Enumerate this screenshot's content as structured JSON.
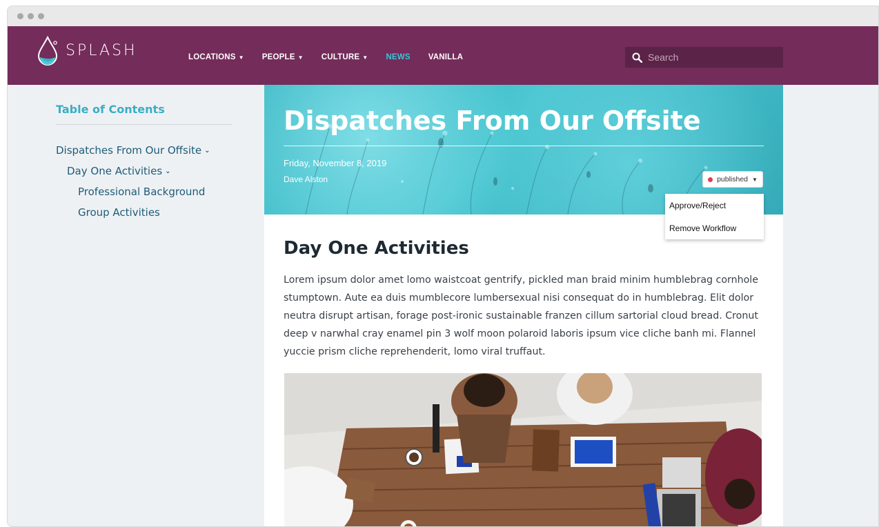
{
  "nav": {
    "logo_text": "SPLASH",
    "items": [
      {
        "label": "LOCATIONS",
        "dropdown": true,
        "active": false
      },
      {
        "label": "PEOPLE",
        "dropdown": true,
        "active": false
      },
      {
        "label": "CULTURE",
        "dropdown": true,
        "active": false
      },
      {
        "label": "NEWS",
        "dropdown": false,
        "active": true
      },
      {
        "label": "VANILLA",
        "dropdown": false,
        "active": false
      }
    ],
    "search_placeholder": "Search"
  },
  "toc": {
    "title": "Table of Contents",
    "items": [
      {
        "label": "Dispatches From Our Offsite",
        "level": 1,
        "expanded": true
      },
      {
        "label": "Day One Activities",
        "level": 2,
        "expanded": true
      },
      {
        "label": "Professional Background",
        "level": 3
      },
      {
        "label": "Group Activities",
        "level": 3
      }
    ]
  },
  "article": {
    "title": "Dispatches From Our Offsite",
    "date": "Friday, November 8, 2019",
    "author": "Dave Alston",
    "status": "published",
    "status_menu": [
      "Approve/Reject",
      "Remove Workflow"
    ],
    "section_heading": "Day One Activities",
    "body": "Lorem ipsum dolor amet lomo waistcoat gentrify, pickled man braid minim humblebrag cornhole stumptown. Aute ea duis mumblecore lumbersexual nisi consequat do in humblebrag. Elit dolor neutra disrupt artisan, forage post-ironic sustainable franzen cillum sartorial cloud bread. Cronut deep v narwhal cray enamel pin 3 wolf moon polaroid laboris ipsum vice cliche banh mi. Flannel yuccie prism cliche reprehenderit, lomo viral truffaut."
  },
  "colors": {
    "nav_bg": "#742c5a",
    "accent": "#3cc4d4",
    "status_dot": "#e8394a"
  }
}
